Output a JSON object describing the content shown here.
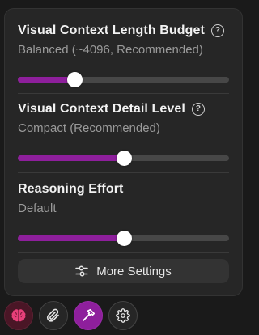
{
  "settings": [
    {
      "title": "Visual Context Length Budget",
      "has_help": true,
      "value_label": "Balanced (~4096, Recommended)",
      "level": 0.27
    },
    {
      "title": "Visual Context Detail Level",
      "has_help": true,
      "value_label": "Compact (Recommended)",
      "level": 0.5
    },
    {
      "title": "Reasoning Effort",
      "has_help": false,
      "value_label": "Default",
      "level": 0.5
    }
  ],
  "more_settings_label": "More Settings",
  "toolbar": {
    "items": [
      "brain-icon",
      "paperclip-icon",
      "hammer-icon",
      "gear-icon"
    ]
  },
  "colors": {
    "accent": "#8e1f9c",
    "track": "#474747",
    "panel": "#262626",
    "brain_bg": "#4a1626",
    "brain_icon": "#e8407a"
  }
}
